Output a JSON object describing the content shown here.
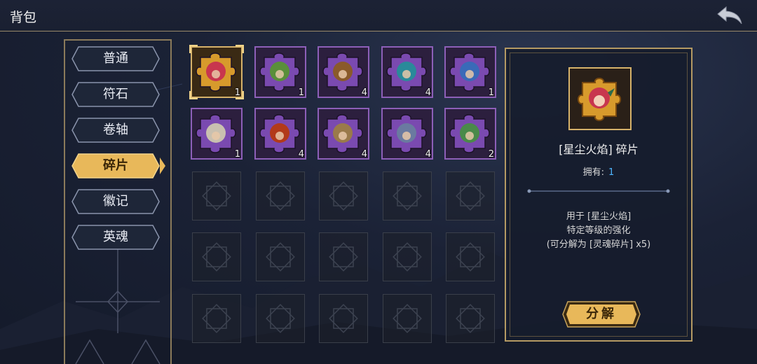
{
  "header": {
    "title": "背包",
    "back_icon": "back-arrow-icon"
  },
  "sidebar": {
    "tabs": [
      {
        "label": "普通",
        "active": false
      },
      {
        "label": "符石",
        "active": false
      },
      {
        "label": "卷轴",
        "active": false
      },
      {
        "label": "碎片",
        "active": true
      },
      {
        "label": "徽记",
        "active": false
      },
      {
        "label": "英魂",
        "active": false
      }
    ]
  },
  "inventory": {
    "items": [
      {
        "name": "hero-fragment-red-hair",
        "count": "1",
        "rarity": "gold",
        "selected": true,
        "color": "#c8364e"
      },
      {
        "name": "hero-fragment-green-beast",
        "count": "1",
        "rarity": "purple",
        "selected": false,
        "color": "#5a8f3a"
      },
      {
        "name": "hero-fragment-brown-beast",
        "count": "4",
        "rarity": "purple",
        "selected": false,
        "color": "#8a5a2a"
      },
      {
        "name": "hero-fragment-teal-dragon",
        "count": "4",
        "rarity": "purple",
        "selected": false,
        "color": "#2a8a9a"
      },
      {
        "name": "hero-fragment-blue-beast",
        "count": "1",
        "rarity": "purple",
        "selected": false,
        "color": "#3a6ab8"
      },
      {
        "name": "hero-fragment-white-hair",
        "count": "1",
        "rarity": "purple",
        "selected": false,
        "color": "#c9c0b0"
      },
      {
        "name": "hero-fragment-fire-demon",
        "count": "4",
        "rarity": "purple",
        "selected": false,
        "color": "#b23a1a"
      },
      {
        "name": "hero-fragment-horned-beast",
        "count": "4",
        "rarity": "purple",
        "selected": false,
        "color": "#9a7a4a"
      },
      {
        "name": "hero-fragment-armored-knight",
        "count": "4",
        "rarity": "purple",
        "selected": false,
        "color": "#6a7aa0"
      },
      {
        "name": "hero-fragment-mushroom",
        "count": "2",
        "rarity": "purple",
        "selected": false,
        "color": "#4a8a4a"
      }
    ],
    "empty_slots": 15
  },
  "detail": {
    "name": "[星尘火焰] 碎片",
    "owned_label": "拥有:",
    "owned_value": "1",
    "desc_lines": [
      "用于 [星尘火焰]",
      "特定等级的强化",
      "(可分解为 [灵魂碎片] x5)"
    ],
    "decompose_label": "分解"
  },
  "colors": {
    "gold": "#d6b26a",
    "purple": "#8d5fb8",
    "accent_blue": "#4fb6ff",
    "tab_active": "#e8b85a"
  }
}
